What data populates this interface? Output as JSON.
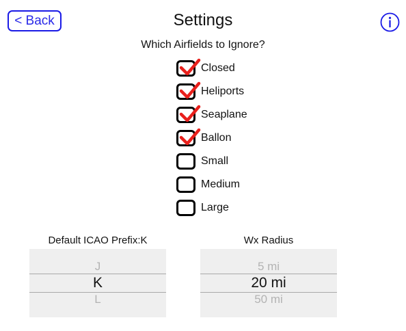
{
  "header": {
    "back_label": "< Back",
    "title": "Settings",
    "info_icon": "info-circle-icon"
  },
  "ignore": {
    "question": "Which Airfields to Ignore?",
    "options": [
      {
        "label": "Closed",
        "checked": true
      },
      {
        "label": "Heliports",
        "checked": true
      },
      {
        "label": "Seaplane",
        "checked": true
      },
      {
        "label": "Ballon",
        "checked": true
      },
      {
        "label": "Small",
        "checked": false
      },
      {
        "label": "Medium",
        "checked": false
      },
      {
        "label": "Large",
        "checked": false
      }
    ]
  },
  "icao_picker": {
    "label": "Default ICAO Prefix:K",
    "above": "J",
    "selected": "K",
    "below": "L"
  },
  "radius_picker": {
    "label": "Wx Radius",
    "above": "5 mi",
    "selected": "20 mi",
    "below": "50 mi"
  },
  "colors": {
    "accent": "#1a1ae6",
    "check": "#e8201c",
    "picker_bg": "#efefef"
  }
}
